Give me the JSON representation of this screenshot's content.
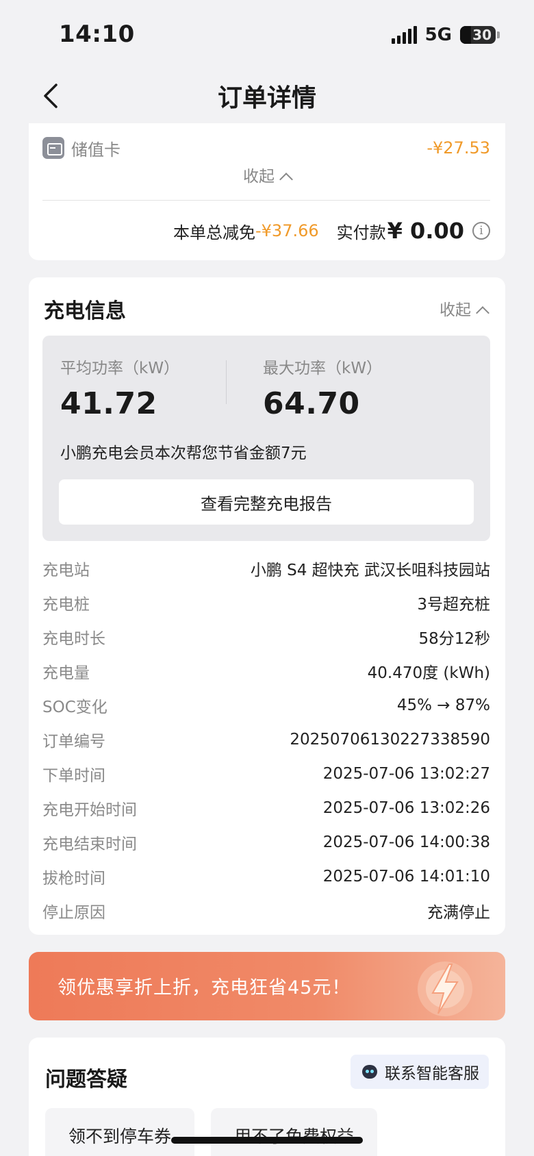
{
  "status_bar": {
    "time": "14:10",
    "network": "5G",
    "battery": "30"
  },
  "nav": {
    "title": "订单详情"
  },
  "payment": {
    "method_label": "储值卡",
    "method_amount": "-¥27.53",
    "collapse_label": "收起",
    "total_discount_label": "本单总减免",
    "total_discount_value": "-¥37.66",
    "paid_label": "实付款",
    "paid_value": "¥ 0.00"
  },
  "charging": {
    "title": "充电信息",
    "collapse_label": "收起",
    "avg_power_label": "平均功率（kW）",
    "avg_power_value": "41.72",
    "max_power_label": "最大功率（kW）",
    "max_power_value": "64.70",
    "saving_text": "小鹏充电会员本次帮您节省金额7元",
    "report_button": "查看完整充电报告",
    "details": [
      {
        "label": "充电站",
        "value": "小鹏 S4 超快充 武汉长咀科技园站"
      },
      {
        "label": "充电桩",
        "value": "3号超充桩"
      },
      {
        "label": "充电时长",
        "value": "58分12秒"
      },
      {
        "label": "充电量",
        "value": "40.470度 (kWh)"
      },
      {
        "label": "SOC变化",
        "value": "45% → 87%"
      },
      {
        "label": "订单编号",
        "value": "20250706130227338590"
      },
      {
        "label": "下单时间",
        "value": "2025-07-06 13:02:27"
      },
      {
        "label": "充电开始时间",
        "value": "2025-07-06 13:02:26"
      },
      {
        "label": "充电结束时间",
        "value": "2025-07-06 14:00:38"
      },
      {
        "label": "拔枪时间",
        "value": "2025-07-06 14:01:10"
      },
      {
        "label": "停止原因",
        "value": "充满停止"
      }
    ]
  },
  "promo": {
    "text": "领优惠享折上折，充电狂省45元！"
  },
  "faq": {
    "title": "问题答疑",
    "service_button": "联系智能客服",
    "tags": [
      "领不到停车券",
      "用不了免费权益"
    ]
  },
  "colors": {
    "accent_orange": "#f09a2a",
    "promo_bg": "#ee7a58"
  }
}
